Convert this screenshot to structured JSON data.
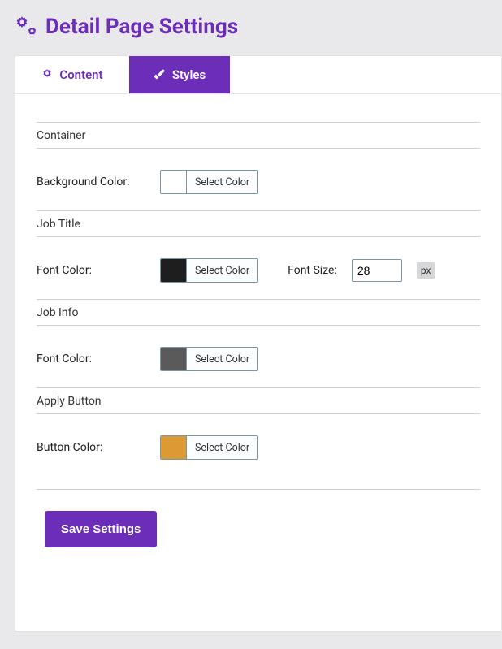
{
  "page_title": "Detail Page Settings",
  "tabs": {
    "content": "Content",
    "styles": "Styles"
  },
  "sections": {
    "container": {
      "heading": "Container",
      "bg_label": "Background Color:",
      "bg_swatch": "#ffffff",
      "bg_btn": "Select Color"
    },
    "job_title": {
      "heading": "Job Title",
      "font_color_label": "Font Color:",
      "font_color_swatch": "#1e1e1e",
      "font_color_btn": "Select Color",
      "font_size_label": "Font Size:",
      "font_size_value": "28",
      "font_size_unit": "px"
    },
    "job_info": {
      "heading": "Job Info",
      "font_color_label": "Font Color:",
      "font_color_swatch": "#5a5a5a",
      "font_color_btn": "Select Color"
    },
    "apply_button": {
      "heading": "Apply Button",
      "button_color_label": "Button Color:",
      "button_color_swatch": "#dd9933",
      "button_color_btn": "Select Color"
    }
  },
  "save_button": "Save Settings"
}
